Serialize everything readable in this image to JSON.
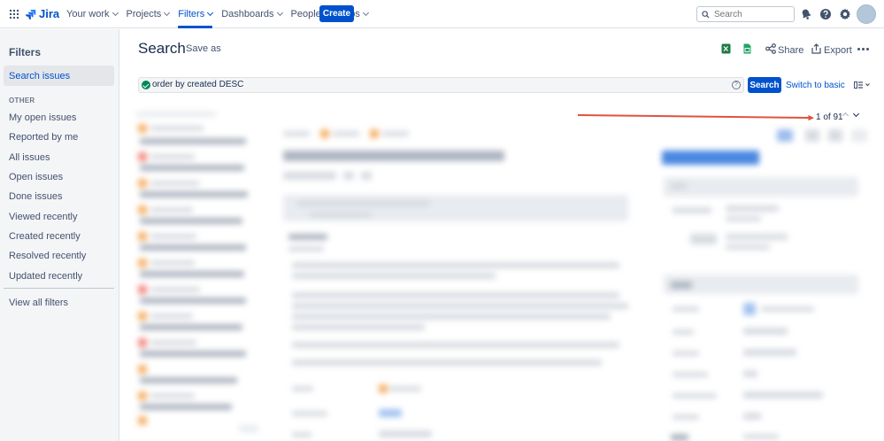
{
  "nav": {
    "logo": "Jira",
    "items": [
      {
        "label": "Your work",
        "active": false
      },
      {
        "label": "Projects",
        "active": false
      },
      {
        "label": "Filters",
        "active": true
      },
      {
        "label": "Dashboards",
        "active": false
      },
      {
        "label": "People",
        "active": false
      },
      {
        "label": "Apps",
        "active": false
      }
    ],
    "create_label": "Create",
    "search_placeholder": "Search",
    "icons": [
      "app-switcher-icon",
      "notifications-icon",
      "help-icon",
      "settings-icon"
    ]
  },
  "sidebar": {
    "title": "Filters",
    "selected": "Search issues",
    "section_heading": "OTHER",
    "items": [
      "My open issues",
      "Reported by me",
      "All issues",
      "Open issues",
      "Done issues",
      "Viewed recently",
      "Created recently",
      "Resolved recently",
      "Updated recently"
    ],
    "view_all": "View all filters"
  },
  "header": {
    "title": "Search",
    "save_as": "Save as",
    "share": "Share",
    "export": "Export"
  },
  "query": {
    "jql": "order by created DESC",
    "search_label": "Search",
    "switch_label": "Switch to basic"
  },
  "pagination": {
    "text": "1 of 91"
  },
  "colors": {
    "brand": "#0052cc",
    "valid": "#00875a",
    "annotation": "#e0533f"
  }
}
